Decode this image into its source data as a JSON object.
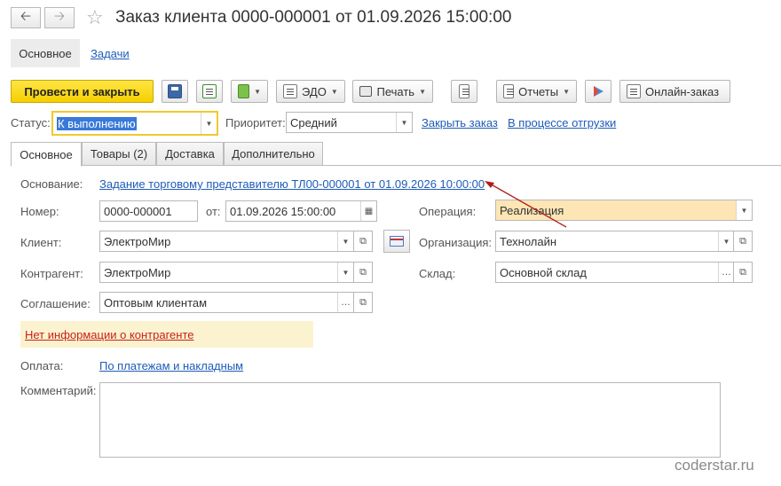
{
  "header": {
    "title": "Заказ клиента 0000-000001 от 01.09.2026 15:00:00",
    "back_icon": "arrow-left-icon",
    "forward_icon": "arrow-right-icon",
    "favorite_icon": "star-icon"
  },
  "top_nav": {
    "active": "Основное",
    "link": "Задачи"
  },
  "toolbar": {
    "post_close": "Провести и закрыть",
    "edo": "ЭДО",
    "print": "Печать",
    "reports": "Отчеты",
    "online_order": "Онлайн-заказ"
  },
  "status_row": {
    "status_label": "Статус:",
    "status_value": "К выполнению",
    "priority_label": "Приоритет:",
    "priority_value": "Средний",
    "close_order": "Закрыть заказ",
    "shipping": "В процессе отгрузки"
  },
  "tabs": [
    "Основное",
    "Товары (2)",
    "Доставка",
    "Дополнительно"
  ],
  "form": {
    "basis_label": "Основание:",
    "basis_value": "Задание торговому представителю ТЛ00-000001 от 01.09.2026 10:00:00",
    "number_label": "Номер:",
    "number_value": "0000-000001",
    "date_label": "от:",
    "date_value": "01.09.2026 15:00:00",
    "client_label": "Клиент:",
    "client_value": "ЭлектроМир",
    "counterparty_label": "Контрагент:",
    "counterparty_value": "ЭлектроМир",
    "agreement_label": "Соглашение:",
    "agreement_value": "Оптовым клиентам",
    "operation_label": "Операция:",
    "operation_value": "Реализация",
    "organization_label": "Организация:",
    "organization_value": "Технолайн",
    "warehouse_label": "Склад:",
    "warehouse_value": "Основной склад",
    "warning": "Нет информации о контрагенте",
    "payment_label": "Оплата:",
    "payment_value": "По платежам и накладным",
    "comment_label": "Комментарий:",
    "comment_value": ""
  },
  "watermark": "coderstar.ru",
  "colors": {
    "primary_button": "#f5cf00",
    "link": "#1f5bb7",
    "warning_text": "#c9211b",
    "warning_bg": "#fbf3cf",
    "operation_bg": "#fde5b5",
    "arrow": "#b01d1d"
  }
}
